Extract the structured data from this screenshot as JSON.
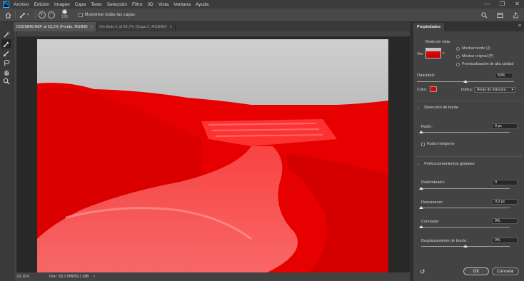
{
  "menubar": {
    "logo": "Ps",
    "items": [
      "Archivo",
      "Edición",
      "Imagen",
      "Capa",
      "Texto",
      "Selección",
      "Filtro",
      "3D",
      "Vista",
      "Ventana",
      "Ayuda"
    ],
    "controls": [
      "—",
      "❐",
      "✕"
    ]
  },
  "options": {
    "brush_size": "179",
    "sample_all_layers_label": "Muestrear todas las capas",
    "sample_all_layers_checked": false
  },
  "tabs": [
    {
      "label": "DSC5849.NEF al 23,1% (Fondo, RGB/8)",
      "active": true
    },
    {
      "label": "Sin título-1 al 66,7% (Capa 2, RGB/8#)",
      "active": false
    }
  ],
  "status": {
    "zoom": "23,11%",
    "doc_info": "Doc: 59,1 MB/59,1 MB"
  },
  "panel": {
    "tab_title": "Propiedades",
    "view_mode_label": "Modo de vista",
    "view_label": "Ver:",
    "view_options": [
      {
        "label": "Mostrar borde (J)",
        "checked": false
      },
      {
        "label": "Mostrar original (P)",
        "checked": false
      },
      {
        "label": "Previsualización de alta calidad",
        "checked": false
      }
    ],
    "opacity": {
      "label": "Opacidad:",
      "value": "50%",
      "level": 0.5
    },
    "color": {
      "label": "Color:",
      "value": "#e60000"
    },
    "indicates": {
      "label": "Indica:",
      "value": "Áreas de máscara"
    },
    "edge_detection": {
      "title": "Detección de borde",
      "radius": {
        "label": "Radio:",
        "value": "0 px",
        "level": 0.0
      },
      "smart_radius": {
        "label": "Radio inteligente",
        "checked": false
      }
    },
    "global_refinements": {
      "title": "Perfeccionamientos globales",
      "smooth": {
        "label": "Redondeado:",
        "value": "0",
        "level": 0.0
      },
      "feather": {
        "label": "Desvanecer:",
        "value": "0,0 px",
        "level": 0.0
      },
      "contrast": {
        "label": "Contraste:",
        "value": "0%",
        "level": 0.0
      },
      "shift_edge": {
        "label": "Desplazamiento de borde:",
        "value": "0%",
        "level": 0.5
      }
    },
    "ok_label": "OK",
    "cancel_label": "Cancelar"
  }
}
